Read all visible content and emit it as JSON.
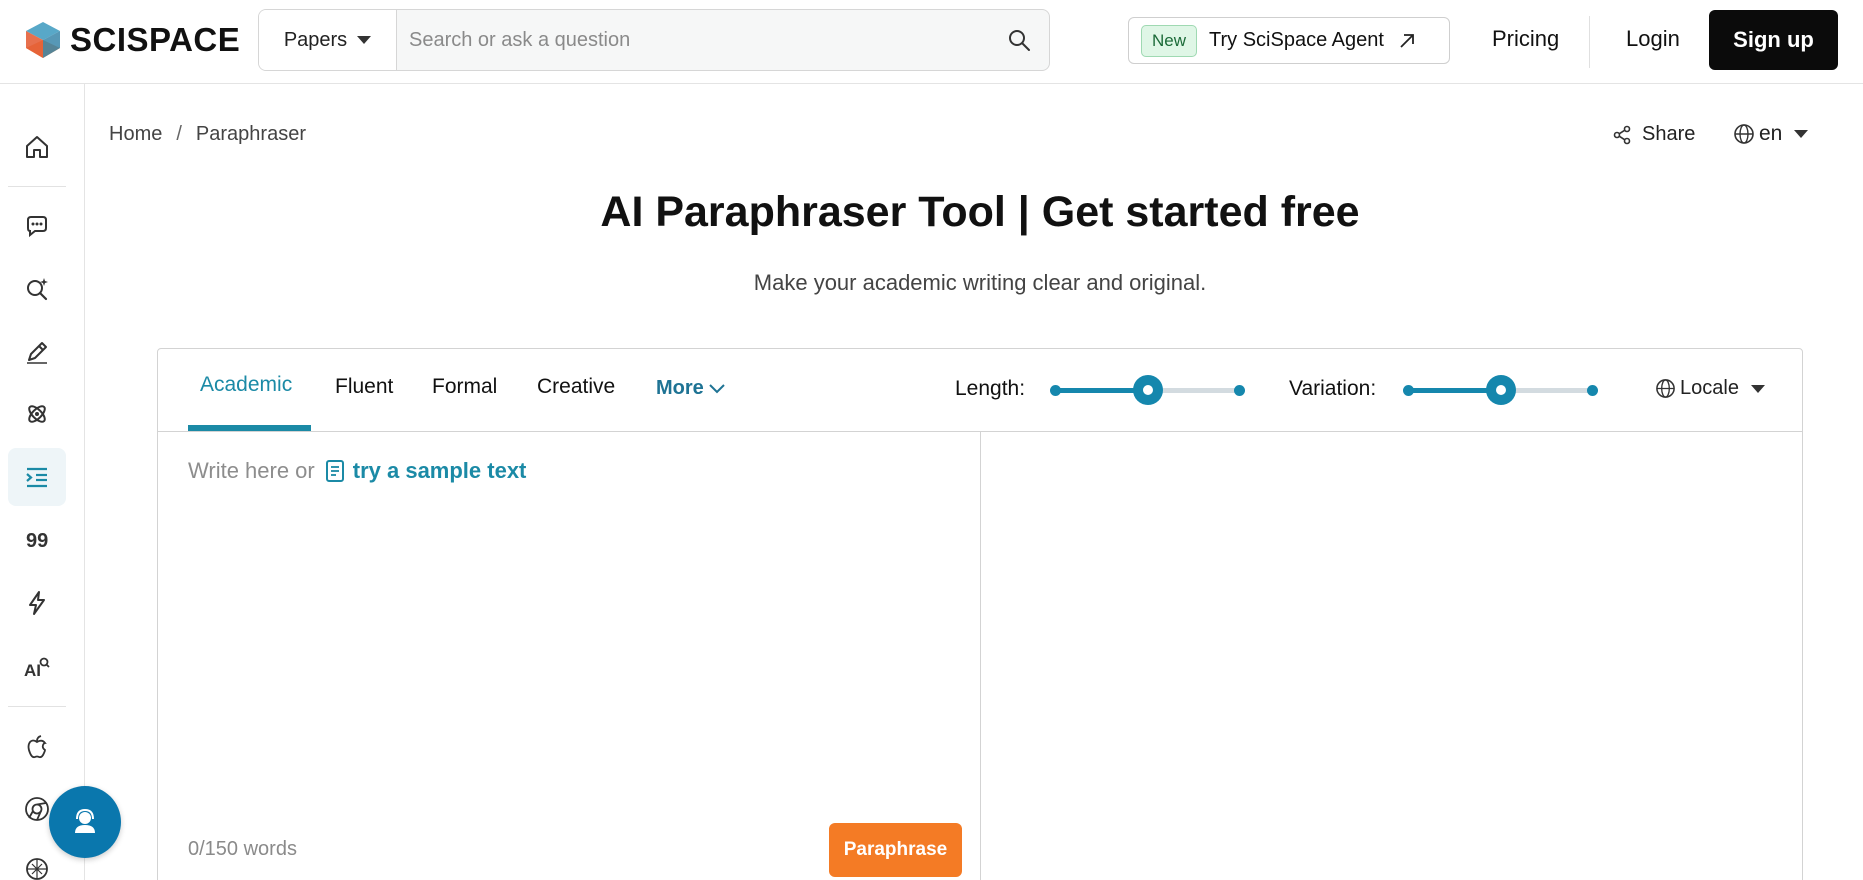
{
  "brand": {
    "name": "SCISPACE"
  },
  "search": {
    "type_label": "Papers",
    "placeholder": "Search or ask a question"
  },
  "header": {
    "new_badge": "New",
    "agent_label": "Try SciSpace Agent",
    "pricing": "Pricing",
    "login": "Login",
    "signup": "Sign up"
  },
  "sidebar": {
    "items": [
      {
        "icon": "home-icon"
      },
      {
        "icon": "chat-icon"
      },
      {
        "icon": "search-sparkle-icon"
      },
      {
        "icon": "pen-icon"
      },
      {
        "icon": "atom-icon"
      },
      {
        "icon": "paraphraser-icon",
        "active": true
      },
      {
        "icon": "quote-icon"
      },
      {
        "icon": "lightning-icon"
      },
      {
        "icon": "ai-detector-icon"
      },
      {
        "icon": "apple-icon"
      },
      {
        "icon": "chrome-icon"
      },
      {
        "icon": "openai-icon"
      }
    ]
  },
  "breadcrumb": {
    "home": "Home",
    "sep": "/",
    "current": "Paraphraser"
  },
  "topbar": {
    "share": "Share",
    "lang": "en"
  },
  "page": {
    "title": "AI Paraphraser Tool | Get started free",
    "subtitle": "Make your academic writing clear and original."
  },
  "tool": {
    "tabs": [
      "Academic",
      "Fluent",
      "Formal",
      "Creative"
    ],
    "active_tab": "Academic",
    "more": "More",
    "length_label": "Length:",
    "length_value": 0.5,
    "variation_label": "Variation:",
    "variation_value": 0.5,
    "locale": "Locale",
    "write_hint": "Write here or",
    "sample_link": "try a sample text",
    "word_count": "0/150 words",
    "paraphrase_btn": "Paraphrase"
  },
  "colors": {
    "accent": "#1b8aa6",
    "slider": "#1587ad",
    "paraphrase": "#f47b25",
    "fab": "#0a77ad"
  }
}
